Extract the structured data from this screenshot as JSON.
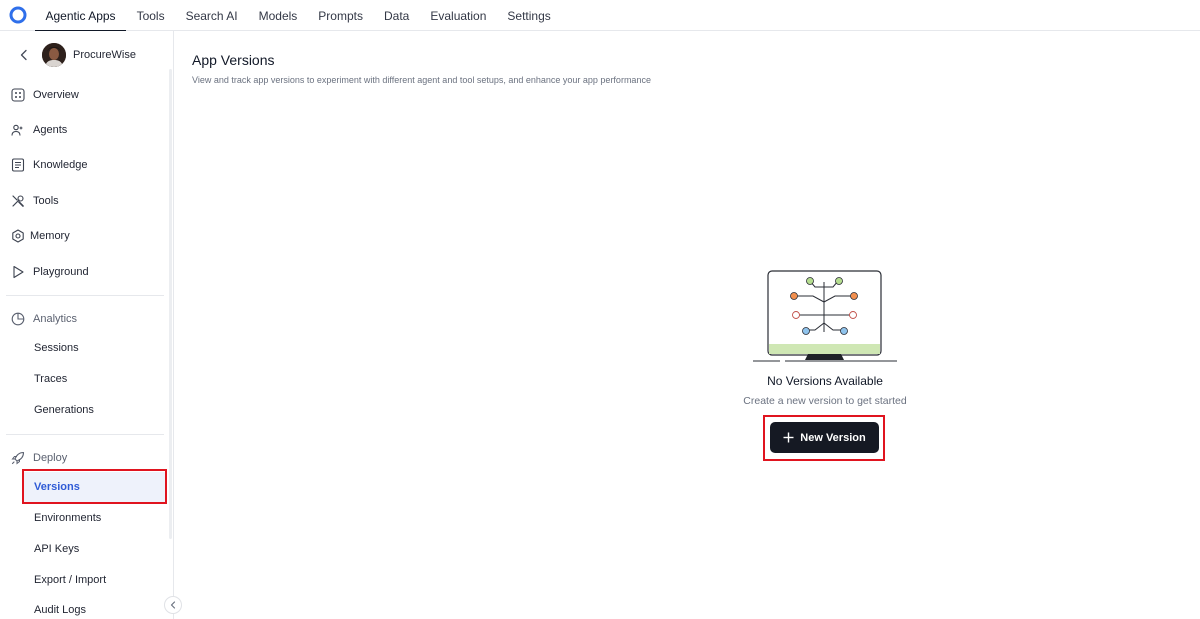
{
  "nav": {
    "items": [
      "Agentic Apps",
      "Tools",
      "Search AI",
      "Models",
      "Prompts",
      "Data",
      "Evaluation",
      "Settings"
    ],
    "active": "Agentic Apps"
  },
  "app": {
    "name": "ProcureWise"
  },
  "sidebar": {
    "main_items": [
      {
        "label": "Overview",
        "icon": "overview-icon"
      },
      {
        "label": "Agents",
        "icon": "agents-icon"
      },
      {
        "label": "Knowledge",
        "icon": "knowledge-icon"
      },
      {
        "label": "Tools",
        "icon": "tools-icon"
      },
      {
        "label": "Memory",
        "icon": "memory-icon"
      },
      {
        "label": "Playground",
        "icon": "play-icon"
      }
    ],
    "analytics": {
      "label": "Analytics",
      "icon": "pie-chart-icon",
      "items": [
        "Sessions",
        "Traces",
        "Generations"
      ]
    },
    "deploy": {
      "label": "Deploy",
      "icon": "rocket-icon",
      "items": [
        "Versions",
        "Environments",
        "API Keys",
        "Export / Import",
        "Audit Logs"
      ],
      "active": "Versions"
    }
  },
  "main": {
    "title": "App Versions",
    "subtitle": "View and track app versions to experiment with different agent and tool setups, and enhance your app performance",
    "empty_state": {
      "title": "No Versions Available",
      "subtitle": "Create a new version to get started",
      "button_label": "New Version"
    }
  },
  "colors": {
    "accent": "#2f5bd6",
    "highlight": "#e0141f",
    "button_bg": "#151923",
    "active_bg": "#eef2fb"
  }
}
